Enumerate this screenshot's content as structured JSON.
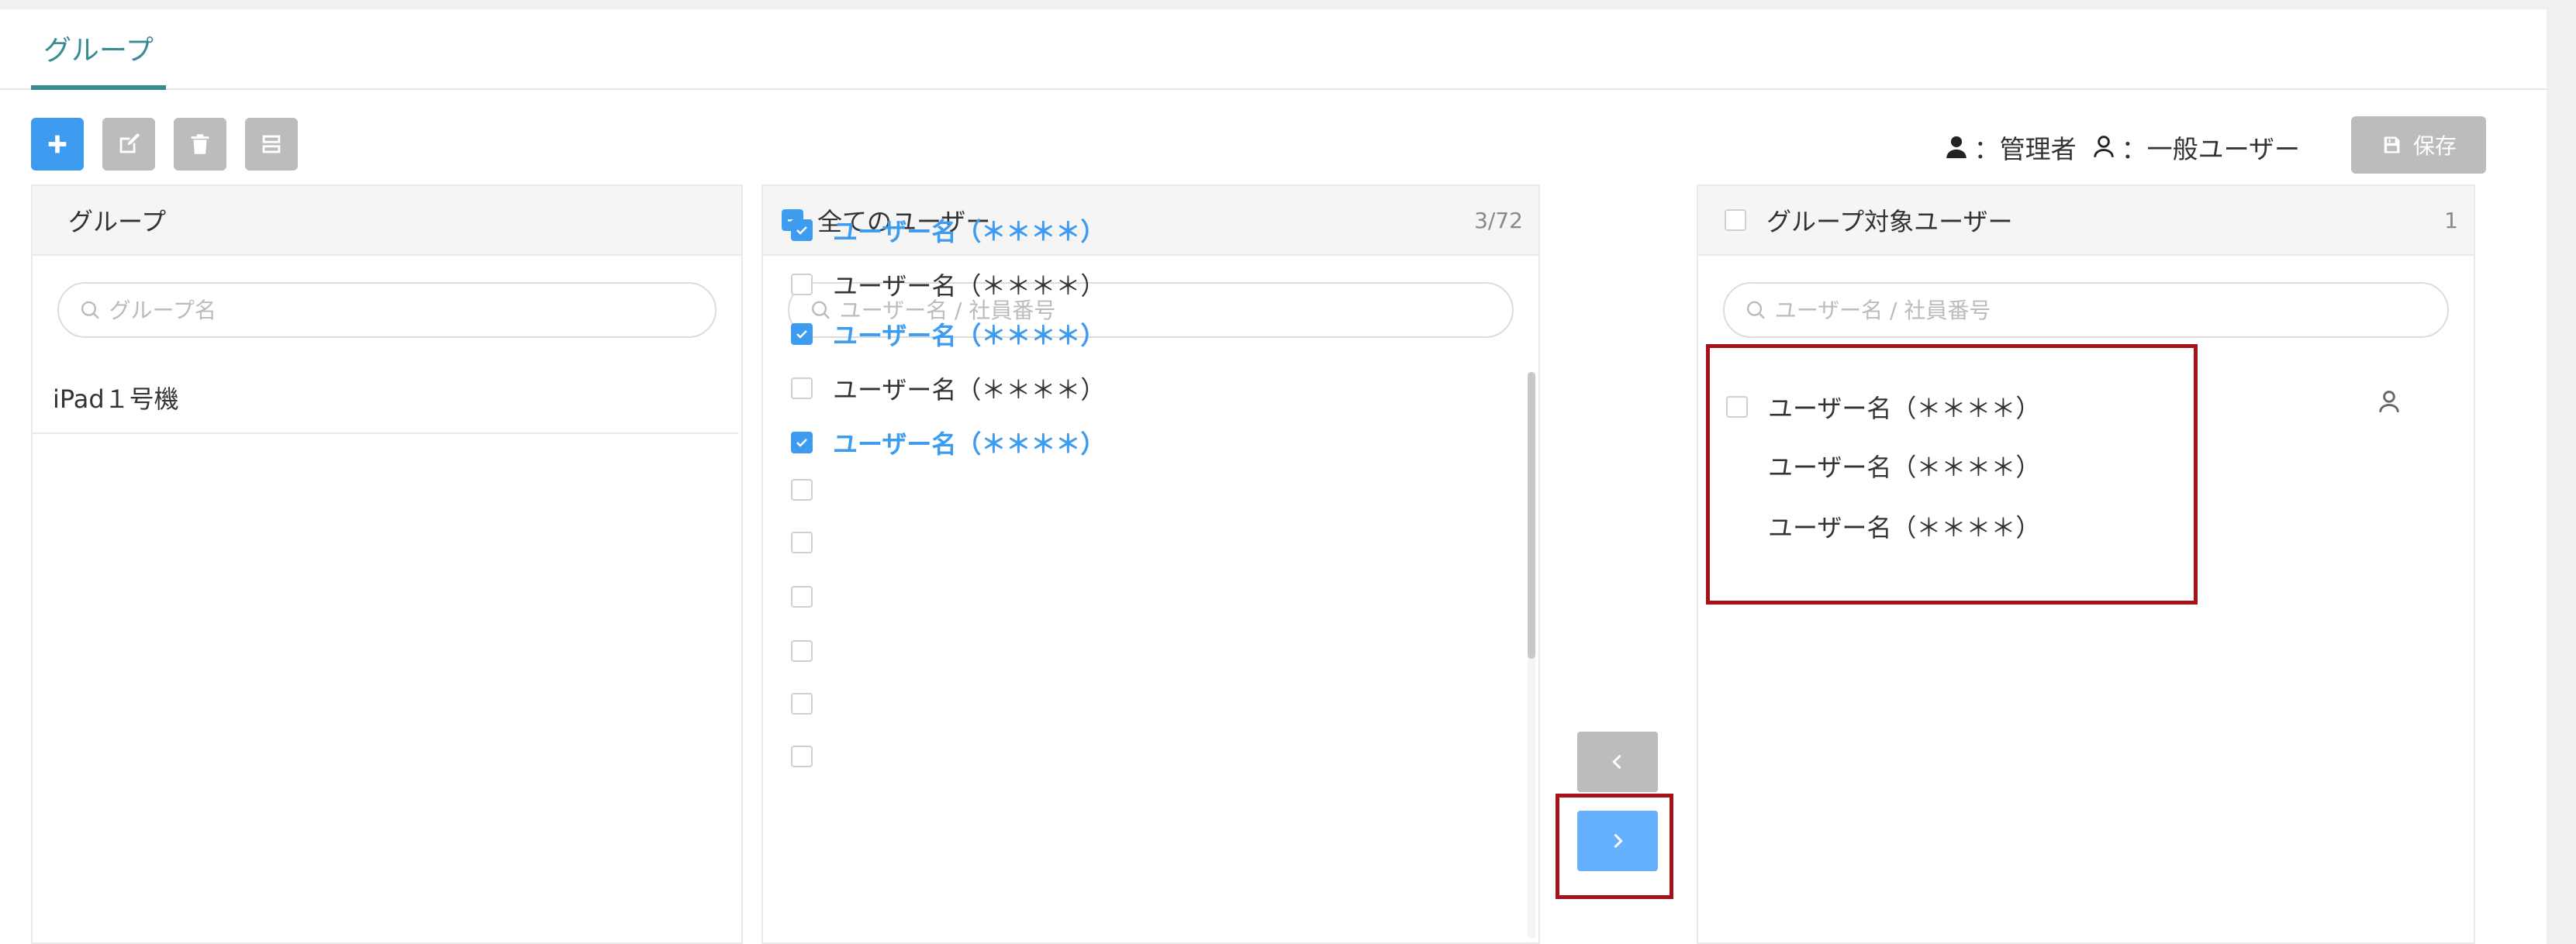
{
  "tabs": {
    "groups_label": "グループ"
  },
  "toolbar": {
    "add": "add",
    "edit": "edit",
    "delete": "delete",
    "copy": "copy"
  },
  "legend": {
    "admin_label": "：管理者",
    "general_label": "：一般ユーザー"
  },
  "save_label": "保存",
  "group_panel": {
    "title": "グループ",
    "search_placeholder": "グループ名",
    "items": [
      {
        "label": "iPad１号機"
      }
    ]
  },
  "all_users_panel": {
    "title": "全てのユーザー",
    "count": "3/72",
    "search_placeholder": "ユーザー名 / 社員番号",
    "items": [
      {
        "label": "ユーザー名（＊＊＊＊）",
        "checked": true
      },
      {
        "label": "ユーザー名（＊＊＊＊）",
        "checked": false
      },
      {
        "label": "ユーザー名（＊＊＊＊）",
        "checked": true
      },
      {
        "label": "ユーザー名（＊＊＊＊）",
        "checked": false
      },
      {
        "label": "ユーザー名（＊＊＊＊）",
        "checked": true
      },
      {
        "label": "",
        "checked": false
      },
      {
        "label": "",
        "checked": false
      },
      {
        "label": "",
        "checked": false
      },
      {
        "label": "",
        "checked": false
      },
      {
        "label": "",
        "checked": false
      },
      {
        "label": "",
        "checked": false
      }
    ]
  },
  "target_panel": {
    "title": "グループ対象ユーザー",
    "count": "1",
    "search_placeholder": "ユーザー名 / 社員番号",
    "items": [
      {
        "label": "ユーザー名（＊＊＊＊）",
        "has_checkbox": true,
        "role": "general"
      },
      {
        "label": "ユーザー名（＊＊＊＊）",
        "has_checkbox": false,
        "role": ""
      },
      {
        "label": "ユーザー名（＊＊＊＊）",
        "has_checkbox": false,
        "role": ""
      }
    ]
  },
  "colors": {
    "accent": "#3d9cf0",
    "tab": "#3a8a94",
    "disabled": "#bcbcbc",
    "highlight": "#a61218",
    "transfer_left": "#bcbcbc",
    "transfer_right": "#66b1ff"
  }
}
